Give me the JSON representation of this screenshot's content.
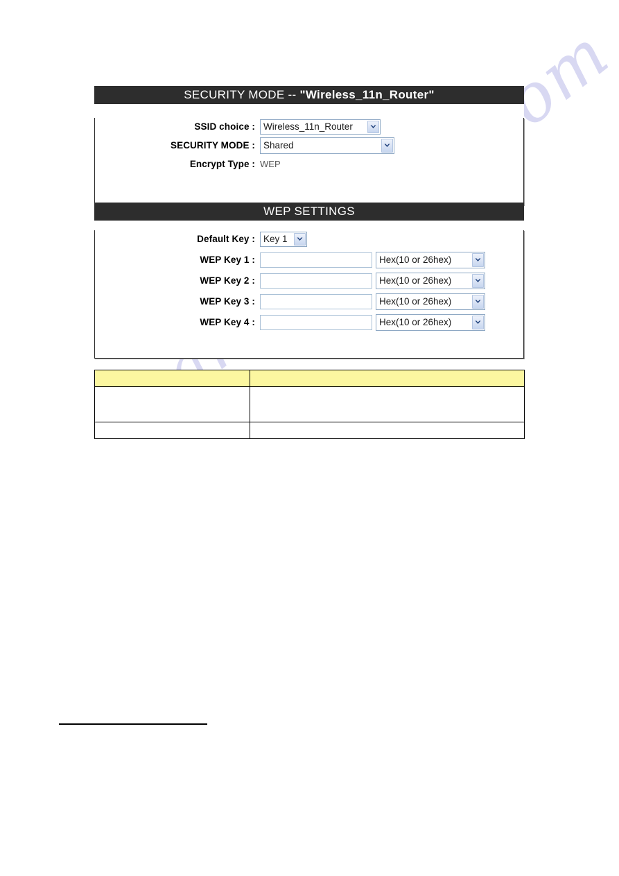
{
  "security_panel": {
    "header_prefix": "SECURITY MODE -- ",
    "header_ssid": "\"Wireless_11n_Router\"",
    "rows": {
      "ssid_choice_label": "SSID choice :",
      "ssid_choice_value": "Wireless_11n_Router",
      "security_mode_label": "SECURITY MODE :",
      "security_mode_value": "Shared",
      "encrypt_type_label": "Encrypt Type :",
      "encrypt_type_value": "WEP"
    }
  },
  "wep_panel": {
    "header": "WEP SETTINGS",
    "default_key_label": "Default Key :",
    "default_key_value": "Key 1",
    "keys": [
      {
        "label": "WEP Key 1 :",
        "value": "",
        "format": "Hex(10 or 26hex)"
      },
      {
        "label": "WEP Key 2 :",
        "value": "",
        "format": "Hex(10 or 26hex)"
      },
      {
        "label": "WEP Key 3 :",
        "value": "",
        "format": "Hex(10 or 26hex)"
      },
      {
        "label": "WEP Key 4 :",
        "value": "",
        "format": "Hex(10 or 26hex)"
      }
    ]
  },
  "spec_table": {
    "rows": [
      {
        "col1": "",
        "col2": ""
      },
      {
        "col1": "",
        "col2": ""
      },
      {
        "col1": "",
        "col2": ""
      }
    ]
  },
  "watermark": {
    "text": "manualshive.com"
  },
  "colors": {
    "header_bar": "#2d2d2d",
    "table_head": "#fcf7a0",
    "select_border": "#8ea8c4",
    "watermark": "#b9b9e8"
  }
}
